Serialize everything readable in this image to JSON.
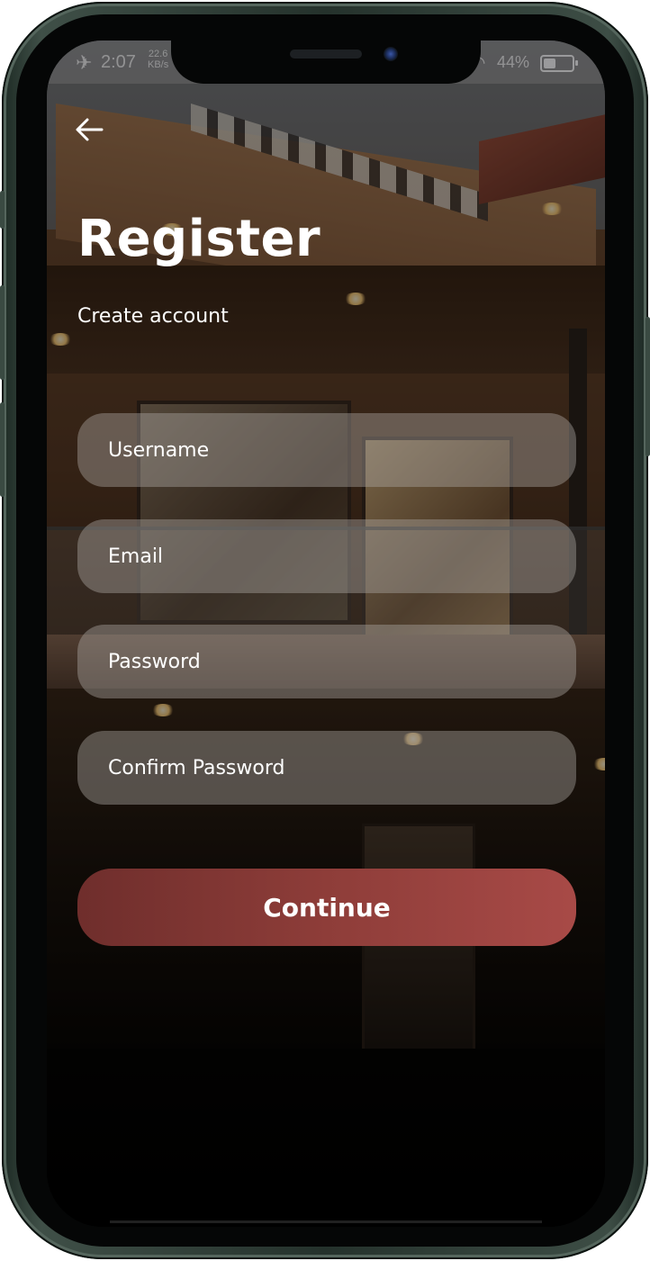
{
  "status_bar": {
    "time": "2:07",
    "net_speed_value": "22.6",
    "net_speed_unit": "KB/s",
    "battery": "44%",
    "battery_level": 0.44,
    "airplane_icon": "airplane-icon",
    "wifi_icon": "wifi-icon"
  },
  "header": {
    "back_icon": "arrow-left-icon",
    "title": "Register",
    "subtitle": "Create account"
  },
  "form": {
    "username_placeholder": "Username",
    "email_placeholder": "Email",
    "password_placeholder": "Password",
    "confirm_password_placeholder": "Confirm Password",
    "continue_label": "Continue"
  },
  "colors": {
    "button_start": "#6f2e2c",
    "button_end": "#a84a47",
    "phone_frame": "#2c3a33"
  }
}
